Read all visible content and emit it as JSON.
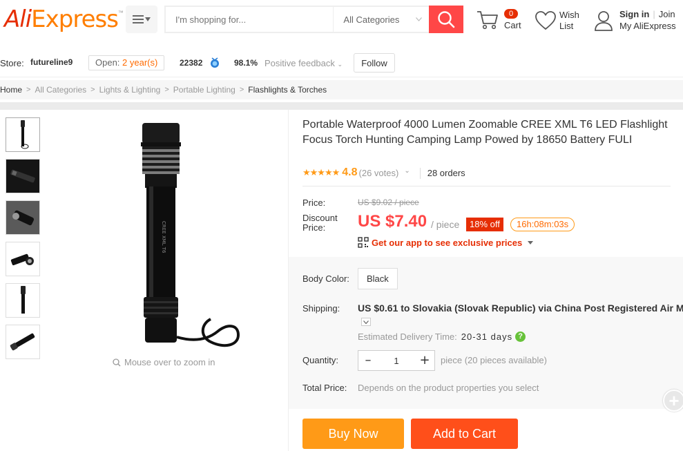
{
  "header": {
    "logo_text_1": "Ali",
    "logo_text_2": "Express",
    "logo_tm": "™",
    "search": {
      "placeholder": "I'm shopping for...",
      "category": "All Categories"
    },
    "cart": {
      "count": "0",
      "label": "Cart"
    },
    "wishlist": {
      "label_1": "Wish",
      "label_2": "List"
    },
    "account": {
      "sign_in": "Sign in",
      "join": "Join",
      "my_account": "My AliExpress"
    }
  },
  "store": {
    "label": "Store:",
    "name": "futureline9",
    "open_prefix": "Open:",
    "open_years": "2 year(s)",
    "score": "22382",
    "feedback_pct": "98.1%",
    "feedback_label": "Positive feedback",
    "follow": "Follow"
  },
  "breadcrumb": [
    "Home",
    "All Categories",
    "Lights & Lighting",
    "Portable Lighting",
    "Flashlights & Torches"
  ],
  "gallery": {
    "zoom_hint": "Mouse over to zoom in"
  },
  "product": {
    "title": "Portable Waterproof 4000 Lumen Zoomable CREE XML T6 LED Flashlight Focus Torch Hunting Camping Lamp Powed by 18650 Battery FULI",
    "stars": "★★★★★",
    "rating": "4.8",
    "votes": "(26 votes)",
    "orders": "28 orders",
    "price_label": "Price:",
    "original_price": "US $9.02 / piece",
    "discount_label": "Discount Price:",
    "discount_price": "US $7.40",
    "per_piece": "/ piece",
    "off": "18% off",
    "timer": "16h:08m:03s",
    "app_promo": "Get our app to see exclusive prices",
    "color_label": "Body Color:",
    "color_value": "Black",
    "shipping_label": "Shipping:",
    "shipping_price": "US $0.61",
    "shipping_to": "to",
    "shipping_dest": "Slovakia (Slovak Republic) via China Post Registered Air Mail",
    "etd_label": "Estimated Delivery Time:",
    "etd_value": "20-31 days",
    "quantity_label": "Quantity:",
    "quantity": "1",
    "quantity_note": "piece (20 pieces available)",
    "total_label": "Total Price:",
    "total_note": "Depends on the product properties you select",
    "buy_now": "Buy Now",
    "add_to_cart": "Add to Cart"
  },
  "colors": {
    "brand_red": "#e62e04",
    "brand_orange": "#ff7e00",
    "buy_now": "#ff9a17",
    "add_cart": "#ff4f1a",
    "price": "#ff4747"
  }
}
